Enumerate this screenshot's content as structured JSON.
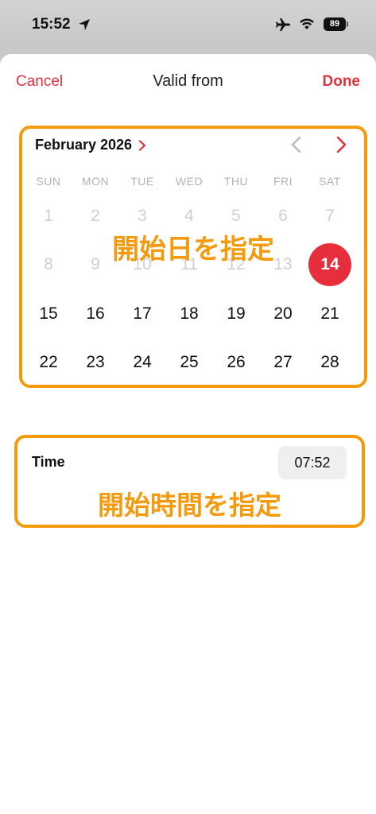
{
  "status_bar": {
    "time": "15:52",
    "battery": "89",
    "icons": [
      "location-arrow-icon",
      "airplane-icon",
      "wifi-icon",
      "battery-icon"
    ]
  },
  "nav": {
    "cancel_label": "Cancel",
    "title": "Valid from",
    "done_label": "Done"
  },
  "calendar": {
    "month_label": "February 2026",
    "weekdays": [
      "SUN",
      "MON",
      "TUE",
      "WED",
      "THU",
      "FRI",
      "SAT"
    ],
    "weeks": [
      [
        "1",
        "2",
        "3",
        "4",
        "5",
        "6",
        "7"
      ],
      [
        "8",
        "9",
        "10",
        "11",
        "12",
        "13",
        "14"
      ],
      [
        "15",
        "16",
        "17",
        "18",
        "19",
        "20",
        "21"
      ],
      [
        "22",
        "23",
        "24",
        "25",
        "26",
        "27",
        "28"
      ]
    ],
    "past_days": [
      "1",
      "2",
      "3",
      "4",
      "5",
      "6",
      "7",
      "8",
      "9",
      "10",
      "11",
      "12",
      "13"
    ],
    "selected_day": "14",
    "annotation": "開始日を指定"
  },
  "time": {
    "label": "Time",
    "value": "07:52",
    "annotation": "開始時間を指定"
  },
  "colors": {
    "accent": "#e0323c",
    "selected": "#e62e3d",
    "highlight": "#f59a0c"
  }
}
